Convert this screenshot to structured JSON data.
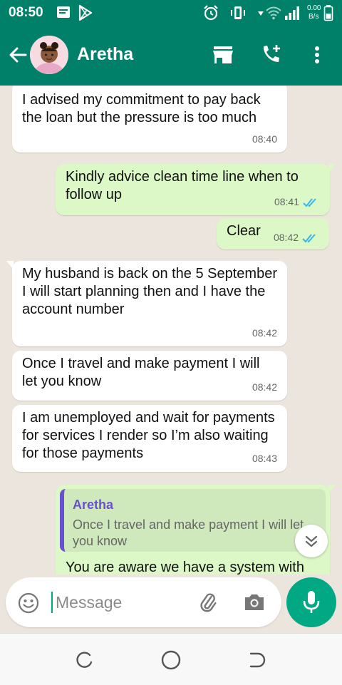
{
  "status_bar": {
    "time": "08:50",
    "net_speed_value": "0.00",
    "net_speed_unit": "B/s",
    "icons": [
      "message-icon",
      "play-store-icon",
      "alarm-icon",
      "vibrate-icon",
      "wifi-icon",
      "signal-icon",
      "battery-icon"
    ]
  },
  "header": {
    "contact_name": "Aretha",
    "icons": [
      "back-arrow-icon",
      "store-icon",
      "add-call-icon",
      "more-vert-icon"
    ]
  },
  "messages": [
    {
      "direction": "in",
      "text": "I advised my commitment to pay back the loan but the pressure is too much",
      "time": "08:40"
    },
    {
      "direction": "out",
      "text": "Kindly advice clean time line when to follow up",
      "time": "08:41",
      "ticks": "read"
    },
    {
      "direction": "out",
      "text": "Clear",
      "time": "08:42",
      "ticks": "read"
    },
    {
      "direction": "in",
      "text": "My husband is back on the 5 September\nI will start planning then and I have the account number",
      "time": "08:42"
    },
    {
      "direction": "in",
      "text": "Once I travel and make payment I will let you know",
      "time": "08:42"
    },
    {
      "direction": "in",
      "text": "I am unemployed and wait for payments for services I render so I’m also waiting for those payments",
      "time": "08:43"
    },
    {
      "direction": "out",
      "reply_to_name": "Aretha",
      "reply_to_text": "Once I travel and make payment I will let you know",
      "text": "You are aware we have a system with"
    }
  ],
  "composer": {
    "placeholder": "Message",
    "value": ""
  },
  "colors": {
    "header": "#008069",
    "accent": "#00a884",
    "outgoing_bubble": "#dcf8c6",
    "incoming_bubble": "#ffffff",
    "chat_bg": "#ece5dd",
    "read_tick": "#34b7f1",
    "quote_bar": "#6a4fd0"
  }
}
